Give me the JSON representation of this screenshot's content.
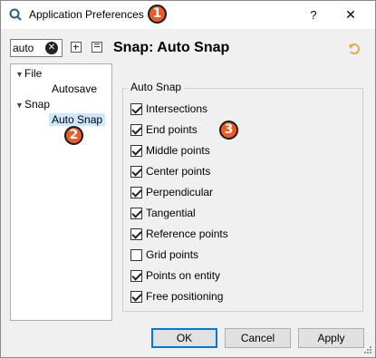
{
  "window": {
    "title": "Application Preferences",
    "help_label": "?",
    "close_label": "✕"
  },
  "badges": [
    "1",
    "2",
    "3"
  ],
  "search": {
    "value": "auto",
    "clear_label": "✕"
  },
  "page_title": "Snap: Auto Snap",
  "tree": {
    "items": [
      {
        "label": "File",
        "expanded": true
      },
      {
        "label": "Autosave"
      },
      {
        "label": "Snap",
        "expanded": true
      },
      {
        "label": "Auto Snap",
        "selected": true
      }
    ]
  },
  "group": {
    "title": "Auto Snap",
    "options": [
      {
        "label": "Intersections",
        "checked": true
      },
      {
        "label": "End points",
        "checked": true
      },
      {
        "label": "Middle points",
        "checked": true
      },
      {
        "label": "Center points",
        "checked": true
      },
      {
        "label": "Perpendicular",
        "checked": true
      },
      {
        "label": "Tangential",
        "checked": true
      },
      {
        "label": "Reference points",
        "checked": true
      },
      {
        "label": "Grid points",
        "checked": false
      },
      {
        "label": "Points on entity",
        "checked": true
      },
      {
        "label": "Free positioning",
        "checked": true
      }
    ]
  },
  "buttons": {
    "ok": "OK",
    "cancel": "Cancel",
    "apply": "Apply"
  },
  "colors": {
    "badge": "#f05a22",
    "selection": "#cce8ff",
    "default_border": "#0078d7"
  }
}
